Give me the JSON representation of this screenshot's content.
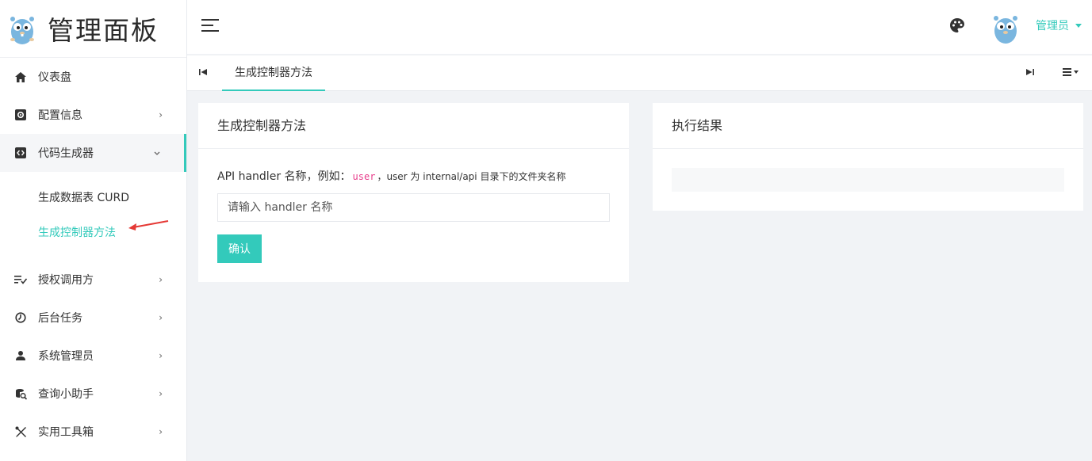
{
  "brand": {
    "title": "管理面板"
  },
  "sidebar": {
    "items": [
      {
        "label": "仪表盘",
        "icon": "home-icon",
        "has_children": false
      },
      {
        "label": "配置信息",
        "icon": "settings-box-icon",
        "has_children": true
      },
      {
        "label": "代码生成器",
        "icon": "code-box-icon",
        "has_children": true,
        "open": true,
        "children": [
          {
            "label": "生成数据表 CURD"
          },
          {
            "label": "生成控制器方法",
            "active": true
          }
        ]
      },
      {
        "label": "授权调用方",
        "icon": "playlist-check-icon",
        "has_children": true
      },
      {
        "label": "后台任务",
        "icon": "timer-icon",
        "has_children": true
      },
      {
        "label": "系统管理员",
        "icon": "user-icon",
        "has_children": true
      },
      {
        "label": "查询小助手",
        "icon": "database-search-icon",
        "has_children": true
      },
      {
        "label": "实用工具箱",
        "icon": "tools-icon",
        "has_children": true
      }
    ]
  },
  "header": {
    "user_label": "管理员"
  },
  "tabs": {
    "active_label": "生成控制器方法"
  },
  "form_card": {
    "title": "生成控制器方法",
    "label_prefix": "API handler 名称，例如：",
    "label_code": "user",
    "label_suffix": "，user 为 internal/api 目录下的文件夹名称",
    "input_placeholder": "请输入 handler 名称",
    "input_value": "",
    "confirm_label": "确认"
  },
  "result_card": {
    "title": "执行结果"
  },
  "colors": {
    "accent": "#33cabb",
    "annotation_arrow": "#e53935",
    "code": "#e83e8c"
  }
}
